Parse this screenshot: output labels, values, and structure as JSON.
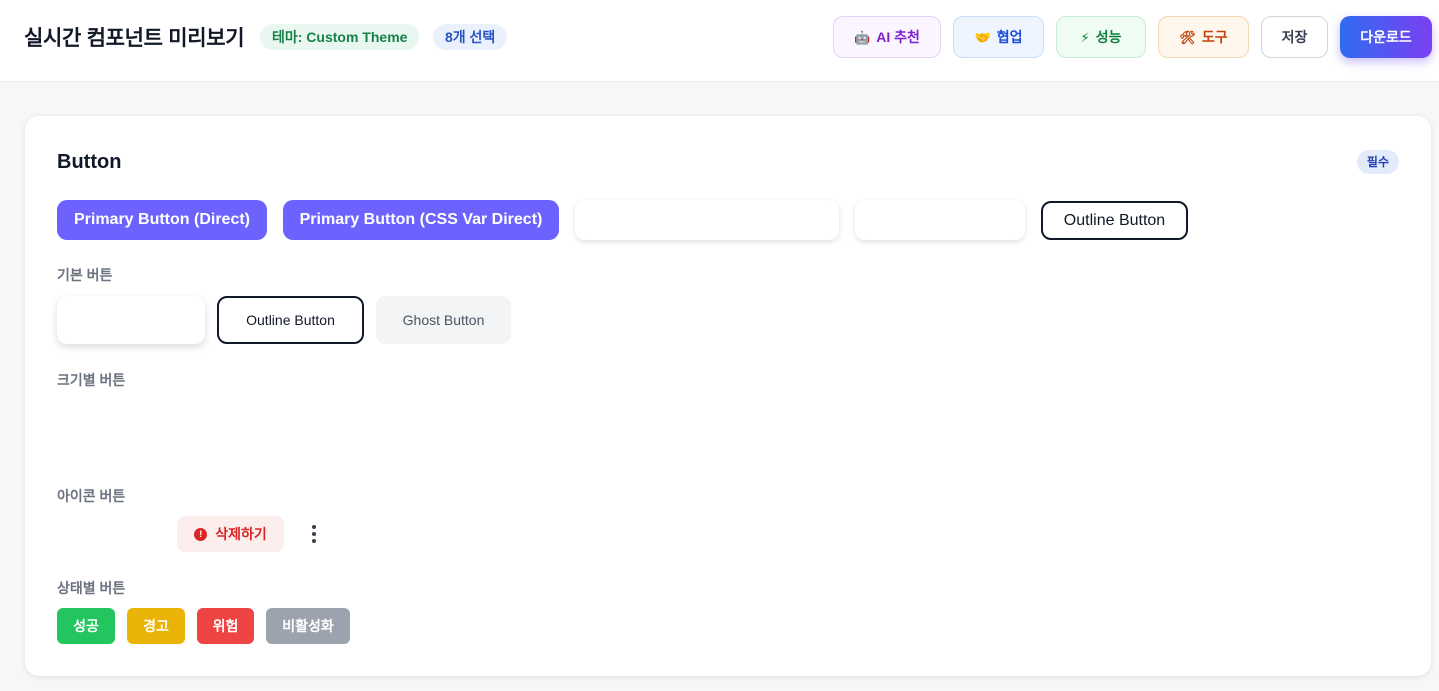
{
  "header": {
    "title": "실시간 컴포넌트 미리보기",
    "theme_badge": "테마: Custom Theme",
    "selection_badge": "8개 선택"
  },
  "toolbar": {
    "ai": {
      "label": "AI 추천",
      "icon": "robot-icon",
      "accent": "#7e22ce"
    },
    "collab": {
      "label": "협업",
      "icon": "handshake-icon",
      "accent": "#1d4ed8"
    },
    "perf": {
      "label": "성능",
      "icon": "lightning-icon",
      "accent": "#15803d"
    },
    "tools": {
      "label": "도구",
      "icon": "tools-icon",
      "accent": "#c2410c"
    },
    "save": {
      "label": "저장"
    },
    "download": {
      "label": "다운로드"
    }
  },
  "card": {
    "title": "Button",
    "badge": "필수",
    "top_row": {
      "primary_direct": "Primary Button (Direct)",
      "primary_cssvar": "Primary Button (CSS Var Direct)",
      "outline": "Outline Button"
    },
    "sections": {
      "basic": {
        "label": "기본 버튼",
        "outline": "Outline Button",
        "ghost": "Ghost Button"
      },
      "size": {
        "label": "크기별 버튼"
      },
      "icon": {
        "label": "아이콘 버튼",
        "delete": "삭제하기",
        "delete_icon": "alert-circle-icon",
        "more_icon": "more-vertical-icon"
      },
      "state": {
        "label": "상태별 버튼",
        "success": "성공",
        "warning": "경고",
        "danger": "위험",
        "disabled": "비활성화"
      }
    }
  },
  "colors": {
    "primary": "#6c63ff",
    "success": "#22c55e",
    "warning": "#eab308",
    "danger": "#ef4444",
    "disabled": "#9ca3af"
  }
}
